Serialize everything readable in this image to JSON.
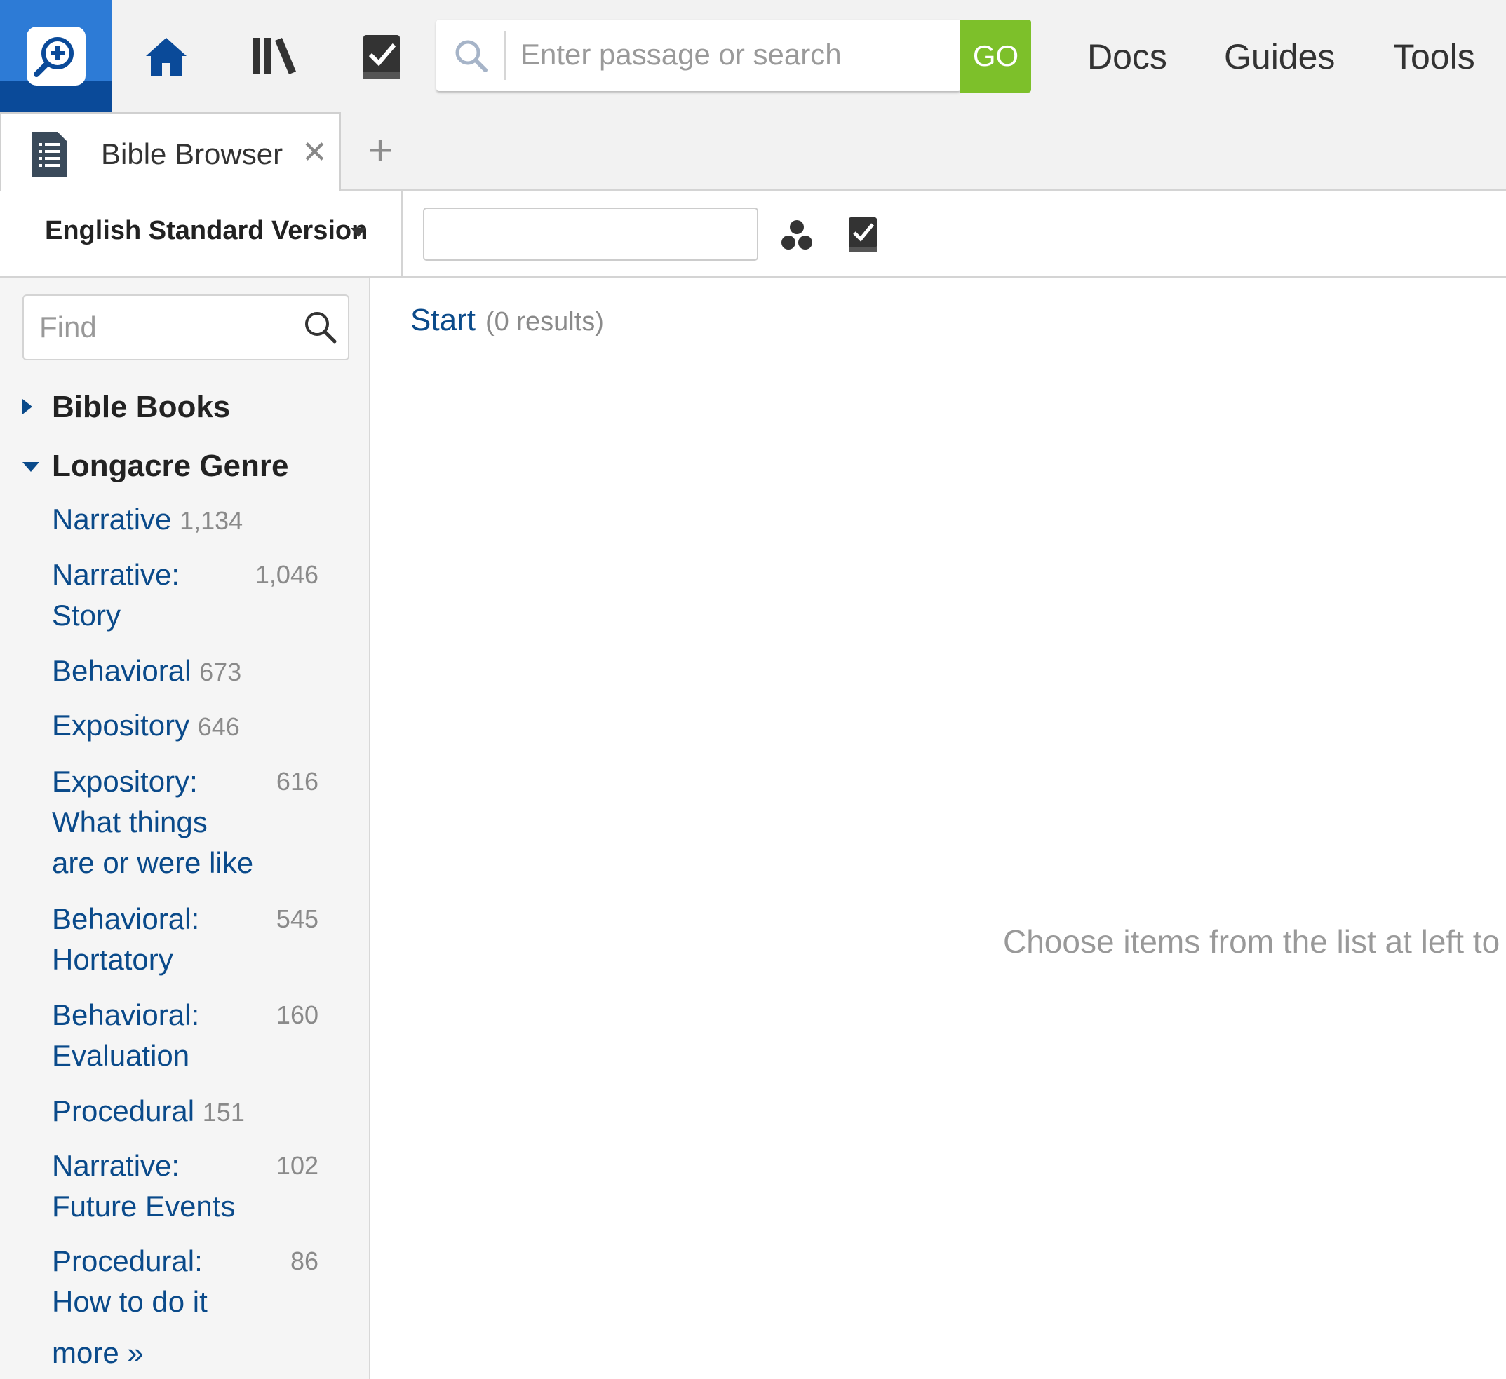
{
  "topbar": {
    "search_placeholder": "Enter passage or search",
    "go_label": "GO",
    "links": [
      "Docs",
      "Guides",
      "Tools"
    ]
  },
  "tabs": {
    "active_label": "Bible Browser",
    "close_glyph": "✕",
    "add_glyph": "+"
  },
  "toolbar": {
    "version": "English Standard Version",
    "reference_value": ""
  },
  "sidebar": {
    "find_placeholder": "Find",
    "sections": [
      {
        "label": "Bible Books",
        "expanded": false
      },
      {
        "label": "Longacre Genre",
        "expanded": true
      }
    ],
    "items": [
      {
        "label": "Narrative",
        "count": "1,134"
      },
      {
        "label": "Narrative: Story",
        "count": "1,046"
      },
      {
        "label": "Behavioral",
        "count": "673"
      },
      {
        "label": "Expository",
        "count": "646"
      },
      {
        "label": "Expository: What things are or were like",
        "count": "616"
      },
      {
        "label": "Behavioral: Hortatory",
        "count": "545"
      },
      {
        "label": "Behavioral: Evaluation",
        "count": "160"
      },
      {
        "label": "Procedural",
        "count": "151"
      },
      {
        "label": "Narrative: Future Events",
        "count": "102"
      },
      {
        "label": "Procedural: How to do it",
        "count": "86"
      }
    ],
    "more_label": "more »"
  },
  "main": {
    "start_label": "Start",
    "results_text": "(0 results)",
    "empty_message": "Choose items from the list at left to"
  },
  "colors": {
    "brand_blue": "#0a4a99",
    "go_green": "#7dc02a",
    "link_blue": "#0a4a8a"
  }
}
